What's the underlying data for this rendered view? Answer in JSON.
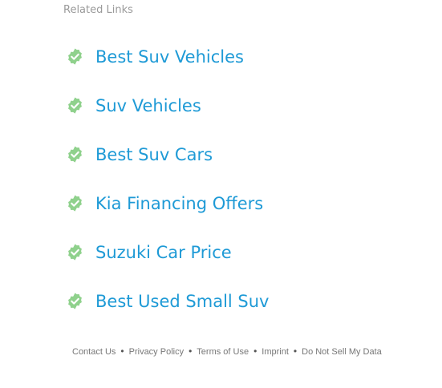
{
  "related_links": {
    "heading": "Related Links",
    "badge_color": "#8fd18c",
    "link_color": "#1e9ad6",
    "items": [
      {
        "label": "Best Suv Vehicles"
      },
      {
        "label": "Suv Vehicles"
      },
      {
        "label": "Best Suv Cars"
      },
      {
        "label": "Kia Financing Offers"
      },
      {
        "label": "Suzuki Car Price"
      },
      {
        "label": "Best Used Small Suv"
      }
    ]
  },
  "footer": {
    "separator": "•",
    "links": [
      {
        "label": "Contact Us"
      },
      {
        "label": "Privacy Policy"
      },
      {
        "label": "Terms of Use"
      },
      {
        "label": "Imprint"
      },
      {
        "label": "Do Not Sell My Data"
      }
    ]
  }
}
